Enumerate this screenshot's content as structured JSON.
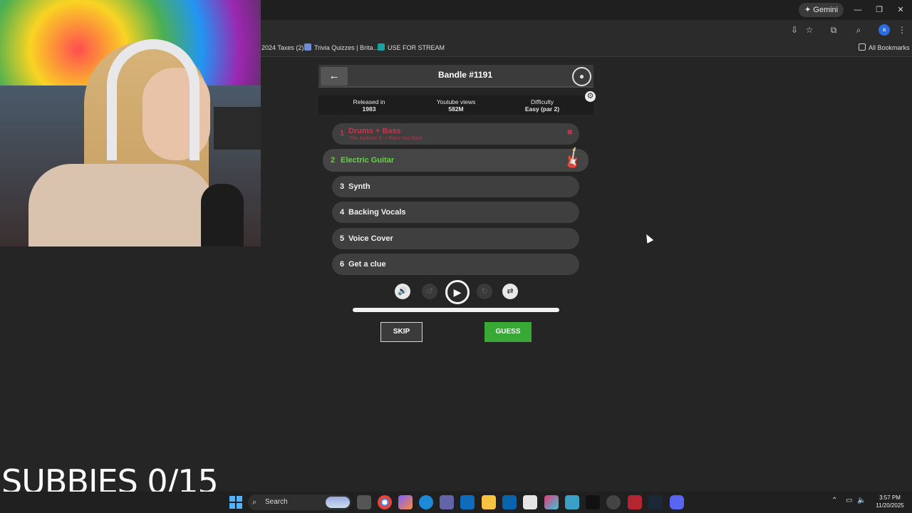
{
  "browser": {
    "gemini_label": "Gemini",
    "bookmarks": [
      {
        "label": "2024 Taxes (2)"
      },
      {
        "label": "Trivia Quizzes | Brita..."
      },
      {
        "label": "USE FOR STREAM"
      }
    ],
    "all_bookmarks_label": "All Bookmarks"
  },
  "game": {
    "title": "Bandle #1191",
    "info": {
      "released_label": "Released in",
      "released_value": "1983",
      "views_label": "Youtube views",
      "views_value": "582M",
      "difficulty_label": "Difficulty",
      "difficulty_value": "Easy (par 2)"
    },
    "tracks": [
      {
        "num": "1",
        "name": "Drums + Bass",
        "sub": "The Jackson 5 - I Want You Back",
        "status": "wrong"
      },
      {
        "num": "2",
        "name": "Electric Guitar",
        "status": "active",
        "icon": "guitar-icon"
      },
      {
        "num": "3",
        "name": "Synth"
      },
      {
        "num": "4",
        "name": "Backing Vocals"
      },
      {
        "num": "5",
        "name": "Voice Cover"
      },
      {
        "num": "6",
        "name": "Get a clue"
      }
    ],
    "skip_label": "SKIP",
    "guess_label": "GUESS",
    "accent_green": "#38a935",
    "wrong_red": "#c8344b"
  },
  "overlay": {
    "subbies_text": "SUBBIES 0/15"
  },
  "taskbar": {
    "search_label": "Search",
    "time": "3:57 PM",
    "date": "11/20/2025"
  }
}
